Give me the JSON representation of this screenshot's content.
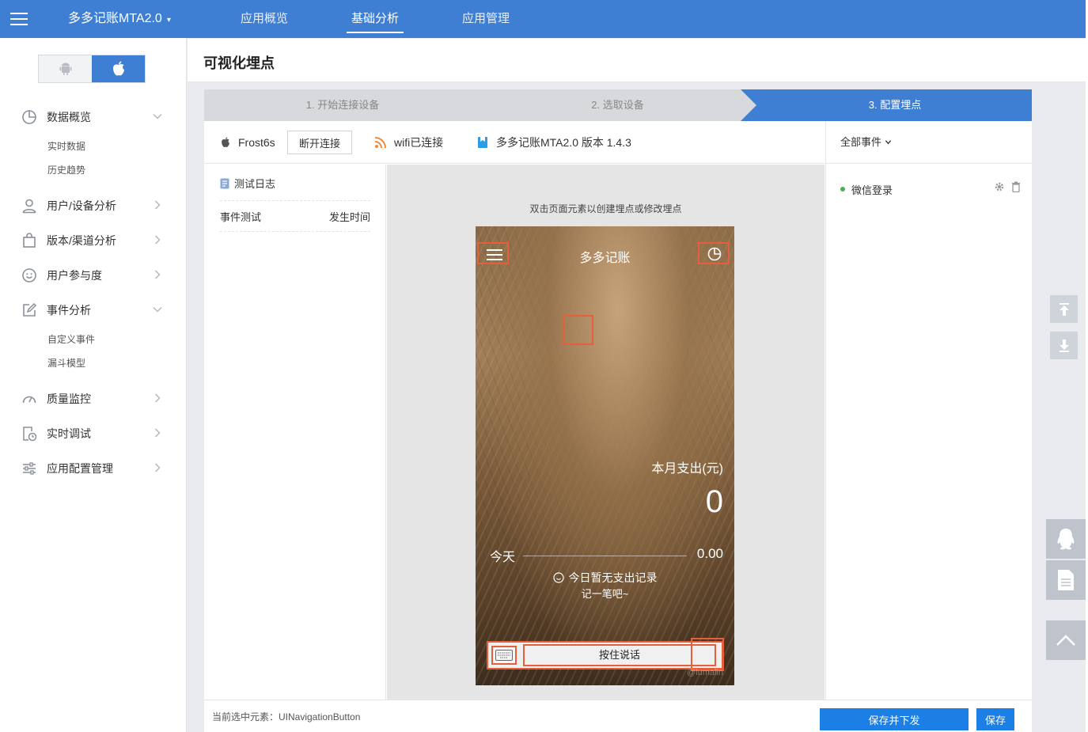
{
  "topbar": {
    "app_name": "多多记账MTA2.0",
    "caret": "▾",
    "tabs": [
      {
        "label": "应用概览"
      },
      {
        "label": "基础分析"
      },
      {
        "label": "应用管理"
      }
    ]
  },
  "sidebar": {
    "os": [
      "android-icon",
      "apple-icon"
    ],
    "items": [
      {
        "label": "数据概览",
        "icon": "pie-chart-icon",
        "subs": [
          "实时数据",
          "历史趋势"
        ]
      },
      {
        "label": "用户/设备分析",
        "icon": "user-icon"
      },
      {
        "label": "版本/渠道分析",
        "icon": "bag-icon"
      },
      {
        "label": "用户参与度",
        "icon": "smile-icon"
      },
      {
        "label": "事件分析",
        "icon": "edit-icon",
        "subs": [
          "自定义事件",
          "漏斗模型"
        ]
      },
      {
        "label": "质量监控",
        "icon": "gauge-icon"
      },
      {
        "label": "实时调试",
        "icon": "clock-doc-icon"
      },
      {
        "label": "应用配置管理",
        "icon": "sliders-icon"
      }
    ]
  },
  "page": {
    "title": "可视化埋点"
  },
  "steps": [
    "1. 开始连接设备",
    "2. 选取设备",
    "3. 配置埋点"
  ],
  "device": {
    "name": "Frost6s",
    "disconnect": "断开连接",
    "wifi": "wifi已连接",
    "app_version": "多多记账MTA2.0 版本 1.4.3"
  },
  "log": {
    "title": "测试日志",
    "col_event": "事件测试",
    "col_time": "发生时间"
  },
  "preview": {
    "hint": "双击页面元素以创建埋点或修改埋点",
    "app_title": "多多记账",
    "month_label": "本月支出(元)",
    "month_value": "0",
    "today_label": "今天",
    "today_value": "0.00",
    "empty_line1": "今日暂无支出记录",
    "empty_line2": "记一笔吧~",
    "talk_button": "按住说话",
    "watermark": "@lumalin"
  },
  "events": {
    "filter": "全部事件",
    "items": [
      {
        "name": "微信登录",
        "status_color": "#4caf50"
      }
    ]
  },
  "footer": {
    "selected": "当前选中元素：UINavigationButton",
    "save_publish": "保存并下发",
    "save": "保存"
  },
  "colors": {
    "brand": "#3f7fd3",
    "highlight": "#e5603a",
    "primary_button": "#1b7fe6"
  }
}
